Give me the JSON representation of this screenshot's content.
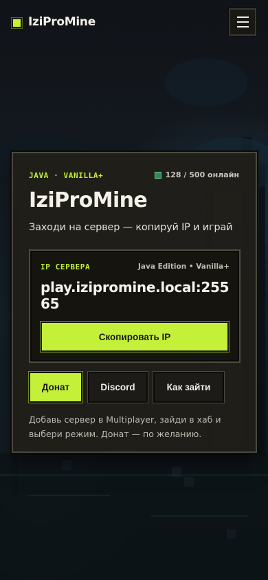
{
  "header": {
    "brand": "IziProMine",
    "menu_icon": "hamburger-menu-icon"
  },
  "card": {
    "tags": "JAVA · VANILLA+",
    "online": "128 / 500 онлайн",
    "title": "IziProMine",
    "subtitle": "Заходи на сервер — копируй IP и играй",
    "ip_box": {
      "label": "IP СЕРВЕРА",
      "edition": "Java Edition • Vanilla+",
      "address": "play.izipromine.local:25565",
      "copy_label": "Скопировать IP"
    },
    "actions": {
      "donate": "Донат",
      "discord": "Discord",
      "howto": "Как зайти"
    },
    "note": "Добавь сервер в Multiplayer, зайди в хаб и выбери режим. Донат — по желанию."
  },
  "colors": {
    "accent": "#c5f03a",
    "online_indicator": "#2f8a57",
    "card_bg": "#201e19",
    "page_bg": "#0e1216"
  }
}
